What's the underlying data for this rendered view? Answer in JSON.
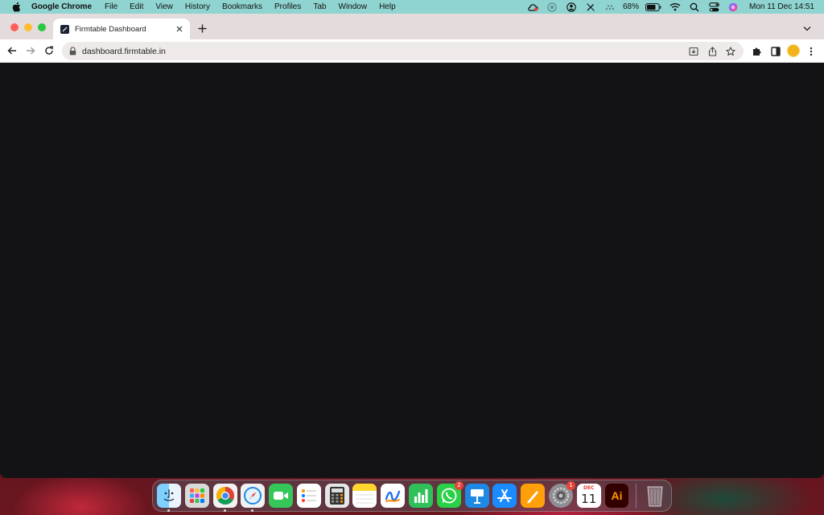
{
  "menubar": {
    "app_name": "Google Chrome",
    "items": [
      "File",
      "Edit",
      "View",
      "History",
      "Bookmarks",
      "Profiles",
      "Tab",
      "Window",
      "Help"
    ],
    "battery_percent": "68%",
    "clock": "Mon 11 Dec  14:51",
    "status_icons": [
      "creative-cloud-icon",
      "focus-icon",
      "user-icon",
      "pen-icon",
      "wifi-dots-icon",
      "battery-icon",
      "wifi-icon",
      "search-icon",
      "control-center-icon",
      "siri-icon"
    ]
  },
  "browser": {
    "tab_title": "Firmtable Dashboard",
    "url": "dashboard.firmtable.in",
    "page_background": "#131315"
  },
  "dock": {
    "apps": [
      {
        "name": "Finder",
        "icon": "finder-icon",
        "running": true
      },
      {
        "name": "Launchpad",
        "icon": "launchpad-icon",
        "running": false
      },
      {
        "name": "Google Chrome",
        "icon": "chrome-icon",
        "running": true
      },
      {
        "name": "Safari",
        "icon": "safari-icon",
        "running": true
      },
      {
        "name": "FaceTime",
        "icon": "facetime-icon",
        "running": false
      },
      {
        "name": "Reminders",
        "icon": "reminders-icon",
        "running": false
      },
      {
        "name": "Calculator",
        "icon": "calculator-icon",
        "running": false
      },
      {
        "name": "Notes",
        "icon": "notes-icon",
        "running": false
      },
      {
        "name": "Freeform",
        "icon": "freeform-icon",
        "running": false
      },
      {
        "name": "Numbers",
        "icon": "numbers-icon",
        "running": false
      },
      {
        "name": "WhatsApp",
        "icon": "whatsapp-icon",
        "running": false,
        "badge": "2"
      },
      {
        "name": "Keynote",
        "icon": "keynote-icon",
        "running": false
      },
      {
        "name": "App Store",
        "icon": "app-store-icon",
        "running": false
      },
      {
        "name": "Pages",
        "icon": "pages-icon",
        "running": false
      },
      {
        "name": "System Settings",
        "icon": "system-settings-icon",
        "running": false,
        "badge": "1"
      },
      {
        "name": "Calendar",
        "icon": "calendar-icon",
        "running": false,
        "month": "DEC",
        "day": "11"
      },
      {
        "name": "Adobe Illustrator",
        "icon": "illustrator-icon",
        "running": false,
        "label": "Ai"
      }
    ],
    "trash": {
      "name": "Trash",
      "icon": "trash-icon"
    }
  }
}
